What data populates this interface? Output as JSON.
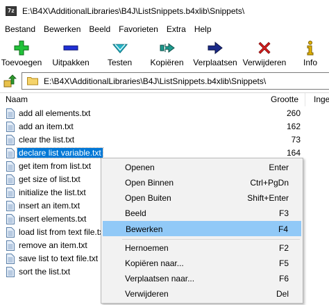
{
  "window": {
    "app_icon_text": "7z",
    "title": "E:\\B4X\\AdditionalLibraries\\B4J\\ListSnippets.b4xlib\\Snippets\\"
  },
  "menubar": [
    "Bestand",
    "Bewerken",
    "Beeld",
    "Favorieten",
    "Extra",
    "Help"
  ],
  "toolbar": [
    {
      "label": "Toevoegen",
      "icon": "plus-icon",
      "color": "#22c23a"
    },
    {
      "label": "Uitpakken",
      "icon": "minus-icon",
      "color": "#1f2fd6"
    },
    {
      "label": "Testen",
      "icon": "check-arrow-icon",
      "color": "#27b5c8"
    },
    {
      "label": "Kopiëren",
      "icon": "copy-arrow-icon",
      "color": "#1e9a8e"
    },
    {
      "label": "Verplaatsen",
      "icon": "move-arrow-icon",
      "color": "#1a2a8a"
    },
    {
      "label": "Verwijderen",
      "icon": "delete-x-icon",
      "color": "#d61e1e"
    },
    {
      "label": "Info",
      "icon": "info-icon",
      "color": "#e0b000"
    }
  ],
  "address": {
    "path": "E:\\B4X\\AdditionalLibraries\\B4J\\ListSnippets.b4xlib\\Snippets\\"
  },
  "columns": {
    "name": "Naam",
    "size": "Grootte",
    "packed": "Inge"
  },
  "files": [
    {
      "name": "add all elements.txt",
      "size": "260"
    },
    {
      "name": "add an item.txt",
      "size": "162"
    },
    {
      "name": "clear the list.txt",
      "size": "73"
    },
    {
      "name": "declare list variable.txt",
      "size": "164",
      "selected": true
    },
    {
      "name": "get item from list.txt",
      "size": ""
    },
    {
      "name": "get size of list.txt",
      "size": ""
    },
    {
      "name": "initialize the list.txt",
      "size": ""
    },
    {
      "name": "insert an item.txt",
      "size": ""
    },
    {
      "name": "insert elements.txt",
      "size": ""
    },
    {
      "name": "load list from text file.txt",
      "size": ""
    },
    {
      "name": "remove an item.txt",
      "size": ""
    },
    {
      "name": "save list to text file.txt",
      "size": ""
    },
    {
      "name": "sort the list.txt",
      "size": ""
    }
  ],
  "context_menu": {
    "highlight_color": "#91c9f7",
    "items": [
      {
        "label": "Openen",
        "shortcut": "Enter"
      },
      {
        "label": "Open Binnen",
        "shortcut": "Ctrl+PgDn"
      },
      {
        "label": "Open Buiten",
        "shortcut": "Shift+Enter"
      },
      {
        "label": "Beeld",
        "shortcut": "F3"
      },
      {
        "label": "Bewerken",
        "shortcut": "F4",
        "highlighted": true
      },
      {
        "separator": true
      },
      {
        "label": "Hernoemen",
        "shortcut": "F2"
      },
      {
        "label": "Kopiëren naar...",
        "shortcut": "F5"
      },
      {
        "label": "Verplaatsen naar...",
        "shortcut": "F6"
      },
      {
        "label": "Verwijderen",
        "shortcut": "Del"
      }
    ]
  }
}
